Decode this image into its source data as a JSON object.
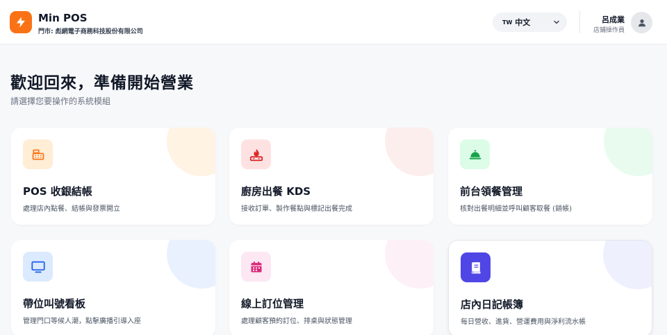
{
  "header": {
    "app_name": "Min POS",
    "store_line": "門市: 彪網電子商務科技股份有限公司",
    "language": {
      "flag_code": "TW",
      "label": "中文"
    },
    "user": {
      "name": "呂成業",
      "role": "店鋪操作員"
    }
  },
  "welcome": {
    "title": "歡迎回來，準備開始營業",
    "subtitle": "請選擇您要操作的系統模組"
  },
  "modules": [
    {
      "title": "POS 收銀結帳",
      "desc": "處理店內點餐、結帳與發票開立",
      "icon": "cash-register-icon",
      "accent": "#f97316",
      "tint": "#ffedd5",
      "blob": "#fff3e4"
    },
    {
      "title": "廚房出餐 KDS",
      "desc": "接收訂單、製作餐點與標記出餐完成",
      "icon": "stove-fire-icon",
      "accent": "#dc2626",
      "tint": "#fee2e2",
      "blob": "#fdeeee"
    },
    {
      "title": "前台領餐管理",
      "desc": "核對出餐明細並呼叫顧客取餐 (銷帳)",
      "icon": "service-bell-icon",
      "accent": "#16a34a",
      "tint": "#dcfce7",
      "blob": "#e9fbef"
    },
    {
      "title": "帶位叫號看板",
      "desc": "管理門口等候人潮，點擊廣播引導入座",
      "icon": "monitor-icon",
      "accent": "#2563eb",
      "tint": "#dbeafe",
      "blob": "#eaf1fe"
    },
    {
      "title": "線上訂位管理",
      "desc": "處理顧客預約訂位、排桌與狀態管理",
      "icon": "calendar-icon",
      "accent": "#db2777",
      "tint": "#fce7f3",
      "blob": "#fdf0f6"
    },
    {
      "title": "店內日記帳簿",
      "desc": "每日營收、進貨、營運費用與淨利流水帳",
      "icon": "ledger-book-icon",
      "accent": "#ffffff",
      "tint": "#4f46e5",
      "blob": "#eef0fd"
    }
  ]
}
